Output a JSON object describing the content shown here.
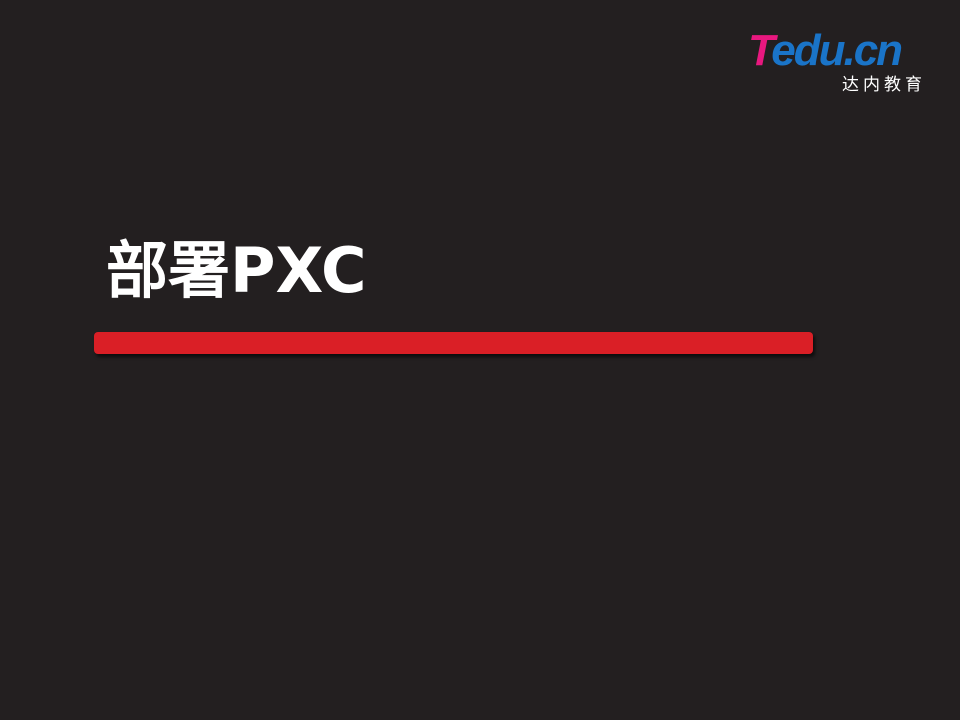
{
  "logo": {
    "mark_t": "T",
    "mark_rest": "edu.cn",
    "tagline": "达内教育"
  },
  "slide": {
    "title": "部署PXC"
  },
  "colors": {
    "background": "#231f20",
    "accent_bar": "#da1f26",
    "logo_pink": "#e8187f",
    "logo_blue": "#1a74c8",
    "title_text": "#ffffff"
  }
}
